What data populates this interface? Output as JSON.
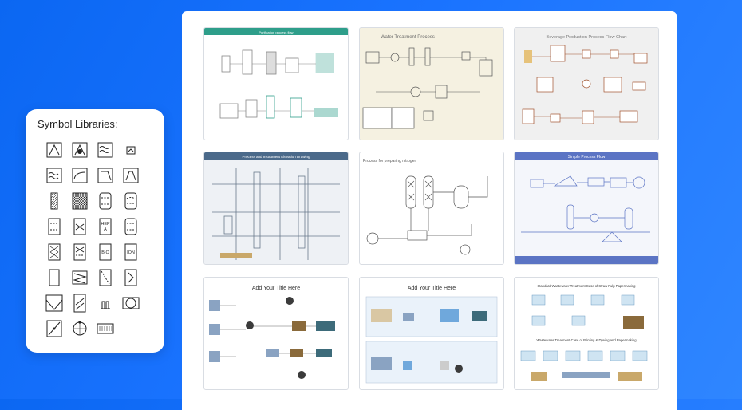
{
  "library": {
    "title": "Symbol Libraries:",
    "symbols": [
      "cone-tank-icon",
      "cone-tank-filled-icon",
      "heat-exchanger-wave-icon",
      "small-box-icon",
      "wave-exchanger-icon",
      "curve-filter-icon",
      "hopper-icon",
      "inverted-hopper-icon",
      "hatched-column-icon",
      "crosshatch-block-icon",
      "dashed-column-icon",
      "dashed-column-2-icon",
      "packed-column-icon",
      "x-column-icon",
      "hep-a-column-icon",
      "dashed-vessel-icon",
      "mesh-column-icon",
      "x-tray-column-icon",
      "bio-column-icon",
      "ion-column-icon",
      "plain-column-icon",
      "zigzag-column-icon",
      "diagonal-column-icon",
      "bracket-column-icon",
      "v-tank-icon",
      "zigzag-tank-icon",
      "double-pipe-icon",
      "rotary-drum-icon",
      "diagonal-box-icon",
      "rotating-circle-icon",
      "grid-block-icon"
    ],
    "labels": {
      "hep": "HEP",
      "a": "A",
      "bio": "BIO",
      "ion": "ION"
    }
  },
  "templates": [
    {
      "title": "Purification process flow",
      "header_color": "#2e9e8a"
    },
    {
      "title": "Water Treatment Process",
      "bg": "#f5f1e1"
    },
    {
      "title": "Beverage Production Process Flow Chart",
      "bg": "#f0f0f0"
    },
    {
      "title": "Process and Instrument Elevation Drawing",
      "header_color": "#4b6a8a"
    },
    {
      "title": "Process for preparing nitrogen"
    },
    {
      "title": "Simple Process Flow",
      "header_color": "#5b74c4"
    },
    {
      "title": "Add Your Title Here"
    },
    {
      "title": "Add Your Title Here"
    },
    {
      "title": "Standard Wastewater Treatment Case of Straw Pulp Papermaking",
      "subtitle": "Wastewater Treatment Case of Printing & Dyeing and Papermaking"
    }
  ]
}
